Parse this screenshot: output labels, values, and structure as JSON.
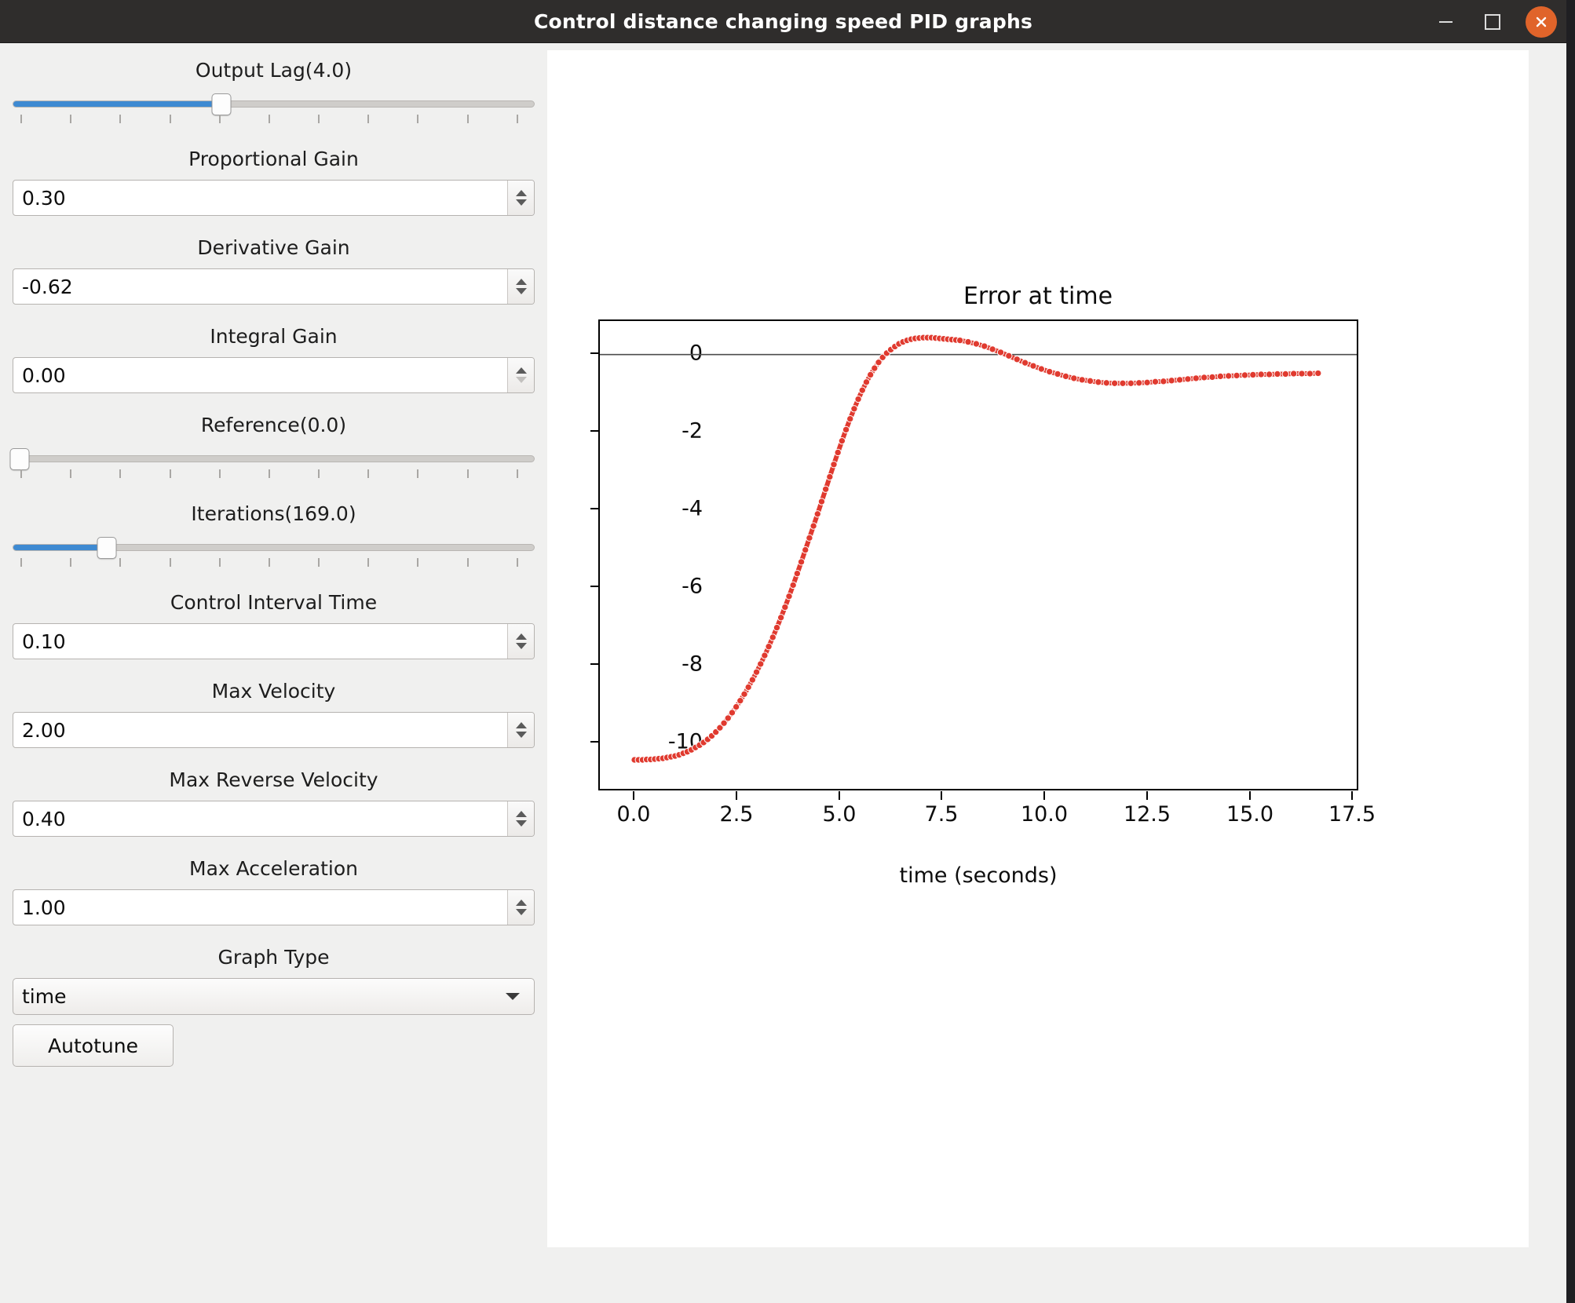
{
  "window": {
    "title": "Control distance changing speed PID graphs",
    "controls": {
      "minimize": "minimize",
      "maximize": "maximize",
      "close": "close"
    },
    "close_color": "#e0642a",
    "titlebar_color": "#2f2d2c"
  },
  "sidebar": {
    "output_lag": {
      "label": "Output Lag(4.0)",
      "value": 4.0,
      "fill_percent": 40
    },
    "proportional_gain": {
      "label": "Proportional Gain",
      "value": "0.30"
    },
    "derivative_gain": {
      "label": "Derivative Gain",
      "value": "-0.62"
    },
    "integral_gain": {
      "label": "Integral Gain",
      "value": "0.00"
    },
    "reference": {
      "label": "Reference(0.0)",
      "value": 0.0,
      "fill_percent": 0
    },
    "iterations": {
      "label": "Iterations(169.0)",
      "value": 169.0,
      "fill_percent": 18
    },
    "control_interval_time": {
      "label": "Control Interval Time",
      "value": "0.10"
    },
    "max_velocity": {
      "label": "Max Velocity",
      "value": "2.00"
    },
    "max_reverse_velocity": {
      "label": "Max Reverse Velocity",
      "value": "0.40"
    },
    "max_acceleration": {
      "label": "Max Acceleration",
      "value": "1.00"
    },
    "graph_type": {
      "label": "Graph Type",
      "value": "time"
    },
    "autotune_button": "Autotune",
    "accent_color": "#3e8ad2"
  },
  "chart_data": {
    "type": "line",
    "title": "Error at time",
    "xlabel": "time (seconds)",
    "ylabel": "",
    "xlim": [
      -0.85,
      17.75
    ],
    "ylim": [
      -10.75,
      1.35
    ],
    "xticks": [
      0.0,
      2.5,
      5.0,
      7.5,
      10.0,
      12.5,
      15.0,
      17.5
    ],
    "xtick_labels": [
      "0.0",
      "2.5",
      "5.0",
      "7.5",
      "10.0",
      "12.5",
      "15.0",
      "17.5"
    ],
    "yticks": [
      0,
      -2,
      -4,
      -6,
      -8,
      -10
    ],
    "ytick_labels": [
      "0",
      "-2",
      "-4",
      "-6",
      "-8",
      "-10"
    ],
    "grid": false,
    "legend": null,
    "reference_line": {
      "y": 0,
      "color": "#4d4d4d"
    },
    "series": [
      {
        "name": "error",
        "color": "#e03a2f",
        "marker": "o",
        "linestyle": "-",
        "x": [
          0.0,
          0.1,
          0.2,
          0.3,
          0.4,
          0.5,
          0.6,
          0.7,
          0.8,
          0.9,
          1.0,
          1.1,
          1.2,
          1.3,
          1.4,
          1.5,
          1.6,
          1.7,
          1.8,
          1.9,
          2.0,
          2.1,
          2.2,
          2.3,
          2.4,
          2.5,
          2.6,
          2.7,
          2.8,
          2.9,
          3.0,
          3.1,
          3.2,
          3.3,
          3.4,
          3.5,
          3.6,
          3.7,
          3.8,
          3.9,
          4.0,
          4.1,
          4.2,
          4.3,
          4.4,
          4.5,
          4.6,
          4.7,
          4.8,
          4.9,
          5.0,
          5.1,
          5.2,
          5.3,
          5.4,
          5.5,
          5.6,
          5.7,
          5.8,
          5.9,
          6.0,
          6.1,
          6.2,
          6.3,
          6.4,
          6.5,
          6.6,
          6.7,
          6.8,
          6.9,
          7.0,
          7.1,
          7.2,
          7.3,
          7.4,
          7.5,
          7.6,
          7.7,
          7.8,
          7.9,
          8.0,
          8.2,
          8.4,
          8.6,
          8.8,
          9.0,
          9.2,
          9.4,
          9.6,
          9.8,
          10.0,
          10.2,
          10.4,
          10.6,
          10.8,
          11.0,
          11.2,
          11.4,
          11.6,
          11.8,
          12.0,
          12.2,
          12.4,
          12.6,
          12.8,
          13.0,
          13.2,
          13.4,
          13.6,
          13.8,
          14.0,
          14.2,
          14.4,
          14.6,
          14.8,
          15.0,
          15.2,
          15.4,
          15.6,
          15.8,
          16.0,
          16.2,
          16.4,
          16.6,
          16.8
        ],
        "y": [
          -10.0,
          -10.0,
          -10.0,
          -9.99,
          -9.99,
          -9.98,
          -9.97,
          -9.96,
          -9.94,
          -9.92,
          -9.9,
          -9.87,
          -9.83,
          -9.79,
          -9.74,
          -9.68,
          -9.62,
          -9.55,
          -9.47,
          -9.38,
          -9.28,
          -9.17,
          -9.05,
          -8.92,
          -8.78,
          -8.63,
          -8.47,
          -8.3,
          -8.12,
          -7.93,
          -7.73,
          -7.52,
          -7.3,
          -7.07,
          -6.83,
          -6.58,
          -6.32,
          -6.05,
          -5.77,
          -5.48,
          -5.18,
          -4.88,
          -4.57,
          -4.26,
          -3.95,
          -3.64,
          -3.32,
          -3.0,
          -2.68,
          -2.36,
          -2.05,
          -1.75,
          -1.46,
          -1.18,
          -0.92,
          -0.67,
          -0.44,
          -0.23,
          -0.04,
          0.13,
          0.28,
          0.41,
          0.52,
          0.61,
          0.69,
          0.76,
          0.81,
          0.85,
          0.88,
          0.9,
          0.91,
          0.92,
          0.92,
          0.92,
          0.91,
          0.9,
          0.89,
          0.88,
          0.87,
          0.86,
          0.85,
          0.81,
          0.76,
          0.7,
          0.62,
          0.54,
          0.45,
          0.36,
          0.27,
          0.19,
          0.11,
          0.04,
          -0.02,
          -0.08,
          -0.13,
          -0.17,
          -0.2,
          -0.23,
          -0.25,
          -0.26,
          -0.26,
          -0.26,
          -0.25,
          -0.24,
          -0.22,
          -0.21,
          -0.19,
          -0.17,
          -0.15,
          -0.13,
          -0.11,
          -0.1,
          -0.08,
          -0.07,
          -0.06,
          -0.05,
          -0.04,
          -0.03,
          -0.03,
          -0.02,
          -0.02,
          -0.01,
          -0.01,
          -0.01,
          0.0
        ]
      }
    ]
  }
}
